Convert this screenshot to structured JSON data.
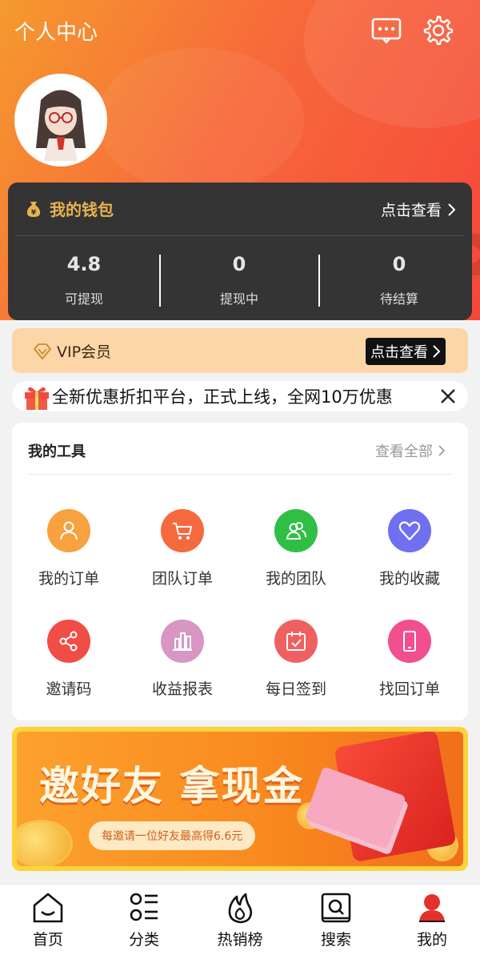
{
  "header": {
    "title": "个人中心"
  },
  "wallet": {
    "title": "我的钱包",
    "link": "点击查看",
    "stats": [
      {
        "value": "4.8",
        "label": "可提现"
      },
      {
        "value": "0",
        "label": "提现中"
      },
      {
        "value": "0",
        "label": "待结算"
      }
    ]
  },
  "vip": {
    "label": "VIP会员",
    "button": "点击查看"
  },
  "notice": {
    "text": "全新优惠折扣平台，正式上线，全网10万优惠"
  },
  "tools": {
    "title": "我的工具",
    "view_all": "查看全部",
    "items": [
      {
        "label": "我的订单",
        "icon": "user-icon",
        "color": "#f7a13f"
      },
      {
        "label": "团队订单",
        "icon": "cart-icon",
        "color": "#f46a3e"
      },
      {
        "label": "我的团队",
        "icon": "team-icon",
        "color": "#2fbf45"
      },
      {
        "label": "我的收藏",
        "icon": "heart-icon",
        "color": "#6f6ff0"
      },
      {
        "label": "邀请码",
        "icon": "share-icon",
        "color": "#f04d45"
      },
      {
        "label": "收益报表",
        "icon": "chart-icon",
        "color": "#d796c4"
      },
      {
        "label": "每日签到",
        "icon": "calendar-icon",
        "color": "#f06060"
      },
      {
        "label": "找回订单",
        "icon": "phone-icon",
        "color": "#f24f8f"
      }
    ]
  },
  "banner": {
    "title": "邀好友 拿现金",
    "subtitle": "每邀请一位好友最高得6.6元"
  },
  "tabbar": {
    "items": [
      {
        "label": "首页",
        "icon": "home-icon"
      },
      {
        "label": "分类",
        "icon": "category-icon"
      },
      {
        "label": "热销榜",
        "icon": "fire-icon"
      },
      {
        "label": "搜索",
        "icon": "search-icon"
      },
      {
        "label": "我的",
        "icon": "profile-icon",
        "active": true
      }
    ]
  }
}
